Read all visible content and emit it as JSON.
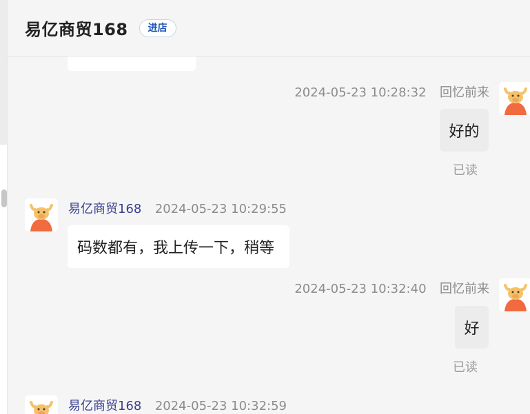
{
  "header": {
    "shop_name": "易亿商贸168",
    "enter_shop_label": "进店"
  },
  "messages": [
    {
      "side": "me",
      "time": "2024-05-23 10:28:32",
      "nickname": "回忆前来",
      "text": "好的",
      "status": "已读"
    },
    {
      "side": "them",
      "sender": "易亿商贸168",
      "time": "2024-05-23 10:29:55",
      "text": "码数都有，我上传一下，稍等"
    },
    {
      "side": "me",
      "time": "2024-05-23 10:32:40",
      "nickname": "回忆前来",
      "text": "好",
      "status": "已读"
    },
    {
      "side": "them",
      "sender": "易亿商贸168",
      "time": "2024-05-23 10:32:59"
    }
  ],
  "colors": {
    "accent_blue": "#1e56b6",
    "sender_name": "#3a3f8f",
    "panel_bg": "#f5f5f5",
    "my_bubble": "#ececec",
    "their_bubble": "#ffffff"
  },
  "icons": {
    "avatar": "cartoon-bull-avatar-icon"
  }
}
